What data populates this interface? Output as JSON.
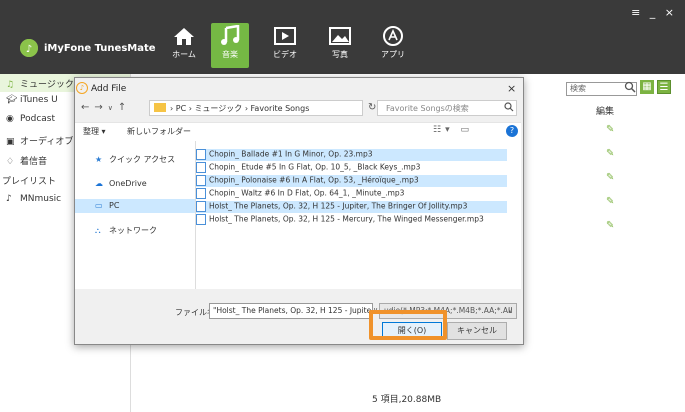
{
  "app": {
    "title": "iMyFone TunesMate",
    "window_controls": "≡ _ ×"
  },
  "nav": [
    {
      "label": "ホーム",
      "icon": "home-icon"
    },
    {
      "label": "音楽",
      "icon": "music-icon",
      "active": true
    },
    {
      "label": "ビデオ",
      "icon": "video-icon"
    },
    {
      "label": "写真",
      "icon": "photo-icon"
    },
    {
      "label": "アプリ",
      "icon": "app-icon"
    }
  ],
  "sidebar": {
    "items": [
      {
        "label": "ミュージック",
        "icon": "music-note-icon"
      },
      {
        "label": "iTunes U",
        "icon": "graduation-cap-icon"
      },
      {
        "label": "Podcast",
        "icon": "podcast-icon"
      },
      {
        "label": "オーディオブック",
        "icon": "audiobook-icon"
      },
      {
        "label": "着信音",
        "icon": "bell-icon"
      },
      {
        "label": "プレイリスト",
        "icon": ""
      },
      {
        "label": "MNmusic",
        "icon": "music-note-icon"
      }
    ]
  },
  "main": {
    "search_placeholder": "検索",
    "edit_header": "編集",
    "footer": "5 項目,20.88MB",
    "accent": "#7cb342"
  },
  "dialog": {
    "title": "Add File",
    "close": "×",
    "address": "› PC › ミュージック › Favorite Songs",
    "search_placeholder": "Favorite Songsの検索",
    "organize": "整理 ▾",
    "new_folder": "新しいフォルダー",
    "nav_items": [
      {
        "label": "クイック アクセス",
        "icon": "star-icon"
      },
      {
        "label": "OneDrive",
        "icon": "cloud-icon"
      },
      {
        "label": "PC",
        "icon": "pc-icon",
        "selected": true
      },
      {
        "label": "ネットワーク",
        "icon": "network-icon"
      }
    ],
    "files": [
      {
        "name": "Chopin_ Ballade #1 In G Minor, Op. 23.mp3",
        "selected": true
      },
      {
        "name": "Chopin_ Etude #5 In G Flat, Op. 10_5, _Black Keys_.mp3",
        "selected": false
      },
      {
        "name": "Chopin_ Polonaise #6 In A Flat, Op. 53, _Héroïque_.mp3",
        "selected": true
      },
      {
        "name": "Chopin_ Waltz #6 In D Flat, Op. 64_1, _Minute_.mp3",
        "selected": false
      },
      {
        "name": "Holst_ The Planets, Op. 32, H 125 - Jupiter, The Bringer Of Jollity.mp3",
        "selected": true
      },
      {
        "name": "Holst_ The Planets, Op. 32, H 125 - Mercury, The Winged Messenger.mp3",
        "selected": false
      }
    ],
    "filename_label": "ファイル名(N):",
    "filename_value": "\"Holst_ The Planets, Op. 32, H 125 - Jupite",
    "filter_value": "udio(*.MP3;*.M4A;*.M4B;*.AA;*.AII",
    "open_label": "開く(O)",
    "cancel_label": "キャンセル"
  }
}
